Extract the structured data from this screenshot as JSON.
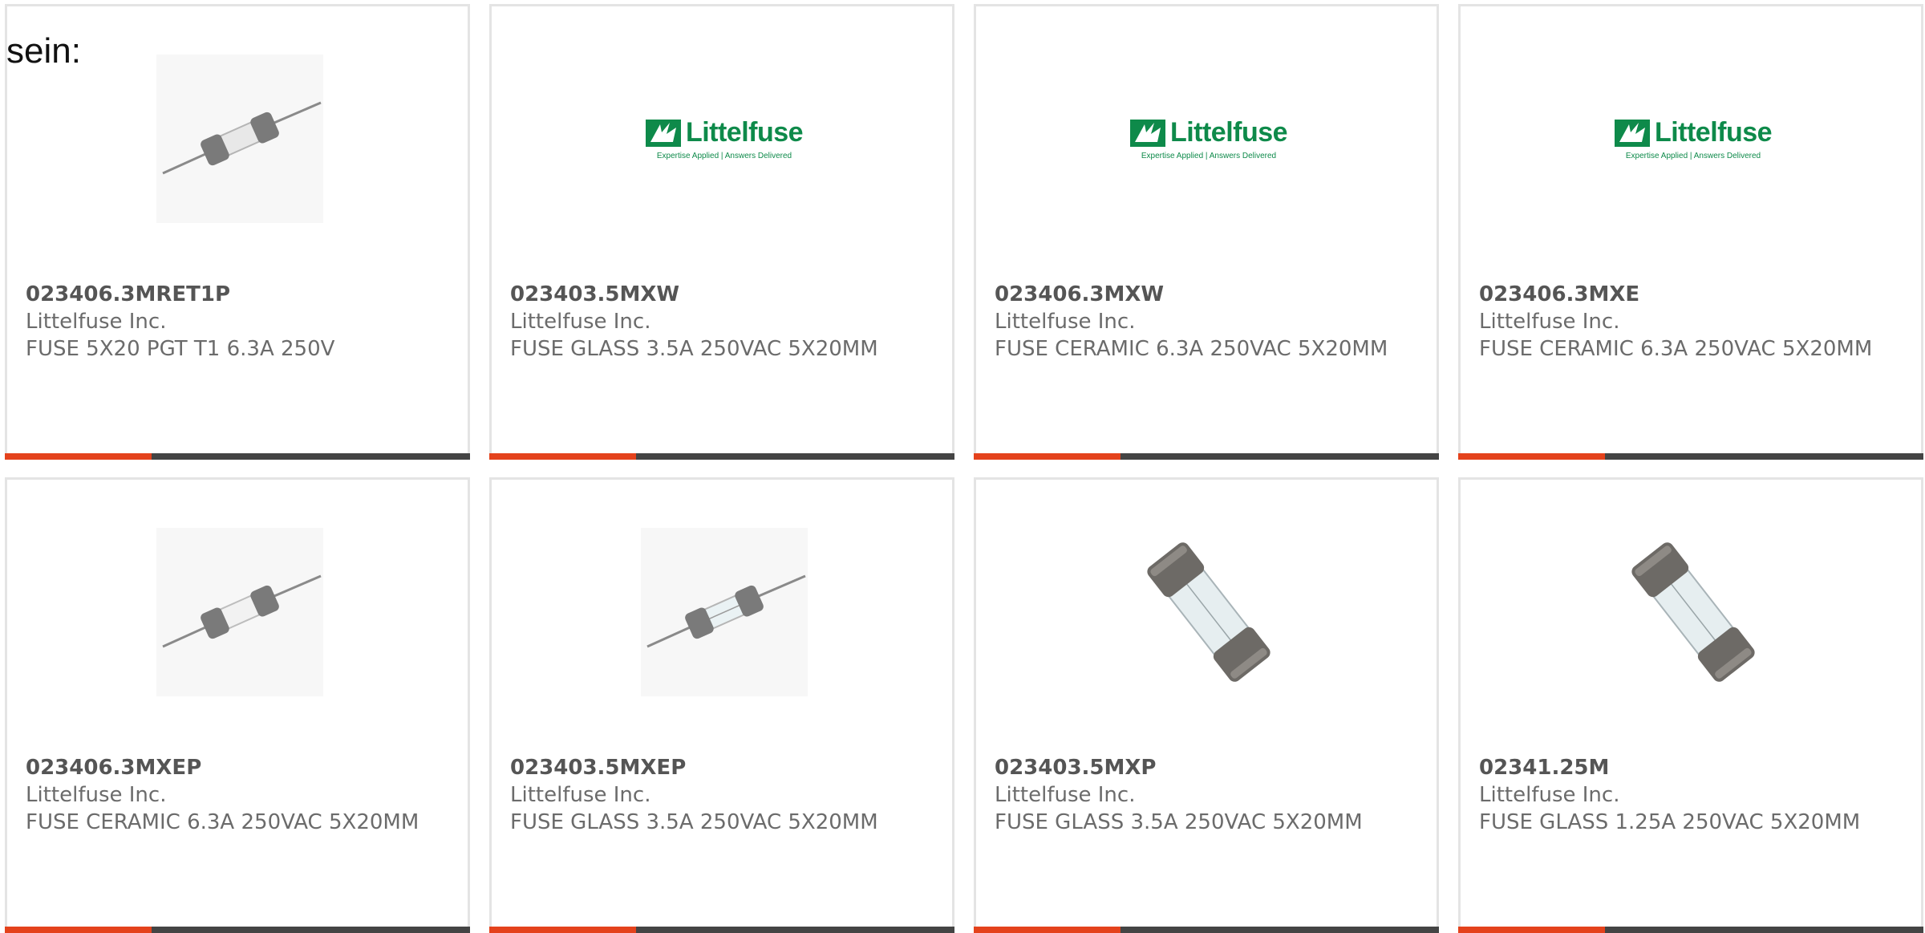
{
  "intro_text": "sein:",
  "colors": {
    "accent": "#e4421c",
    "bar": "#444444",
    "logo_green": "#0e8a4a"
  },
  "products": [
    {
      "part_number": "023406.3MRET1P",
      "manufacturer": "Littelfuse Inc.",
      "description": "FUSE 5X20 PGT T1 6.3A 250V",
      "image": "axial-fuse-image"
    },
    {
      "part_number": "023403.5MXW",
      "manufacturer": "Littelfuse Inc.",
      "description": "FUSE GLASS 3.5A 250VAC 5X20MM",
      "image": "littelfuse-logo"
    },
    {
      "part_number": "023406.3MXW",
      "manufacturer": "Littelfuse Inc.",
      "description": "FUSE CERAMIC 6.3A 250VAC 5X20MM",
      "image": "littelfuse-logo"
    },
    {
      "part_number": "023406.3MXE",
      "manufacturer": "Littelfuse Inc.",
      "description": "FUSE CERAMIC 6.3A 250VAC 5X20MM",
      "image": "littelfuse-logo"
    },
    {
      "part_number": "023406.3MXEP",
      "manufacturer": "Littelfuse Inc.",
      "description": "FUSE CERAMIC 6.3A 250VAC 5X20MM",
      "image": "axial-fuse-image"
    },
    {
      "part_number": "023403.5MXEP",
      "manufacturer": "Littelfuse Inc.",
      "description": "FUSE GLASS 3.5A 250VAC 5X20MM",
      "image": "axial-fuse-image"
    },
    {
      "part_number": "023403.5MXP",
      "manufacturer": "Littelfuse Inc.",
      "description": "FUSE GLASS 3.5A 250VAC 5X20MM",
      "image": "cartridge-fuse-image"
    },
    {
      "part_number": "02341.25M",
      "manufacturer": "Littelfuse Inc.",
      "description": "FUSE GLASS 1.25A 250VAC 5X20MM",
      "image": "cartridge-fuse-image"
    }
  ],
  "logo": {
    "name": "Littelfuse",
    "tagline": "Expertise Applied | Answers Delivered"
  }
}
